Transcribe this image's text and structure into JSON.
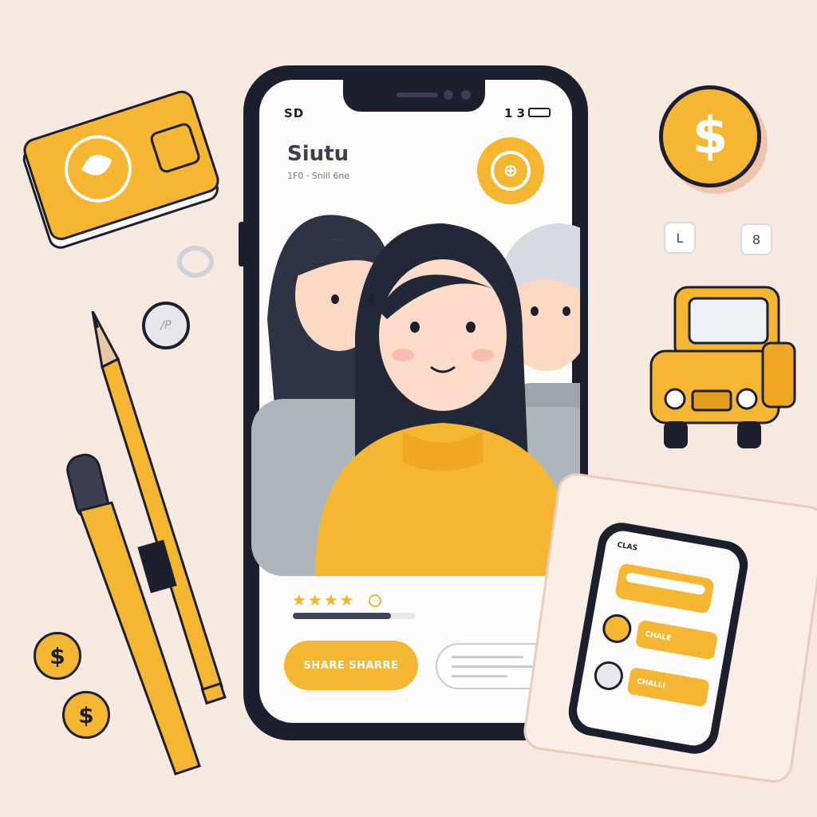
{
  "status_bar": {
    "left_text": "SD",
    "right_text": "1 3"
  },
  "app": {
    "title": "Siutu",
    "subtitle": "1F0 · Sniil 6ne",
    "badge_glyph": "⊕"
  },
  "rating": {
    "stars": "★★★★",
    "progress": 0.8
  },
  "buttons": {
    "share_label": "SHARE SHARRE"
  },
  "mini_phone": {
    "title": "CLAS",
    "items": [
      {
        "label": "CHALE"
      },
      {
        "label": "CHALLI"
      }
    ]
  },
  "decor": {
    "coin_symbol": "$",
    "chat_glyph_1": "L",
    "chat_glyph_2": "8",
    "tag_glyph": "/P"
  },
  "colors": {
    "accent": "#f5b731",
    "dark": "#1c1f2e",
    "background": "#f7e9df"
  }
}
